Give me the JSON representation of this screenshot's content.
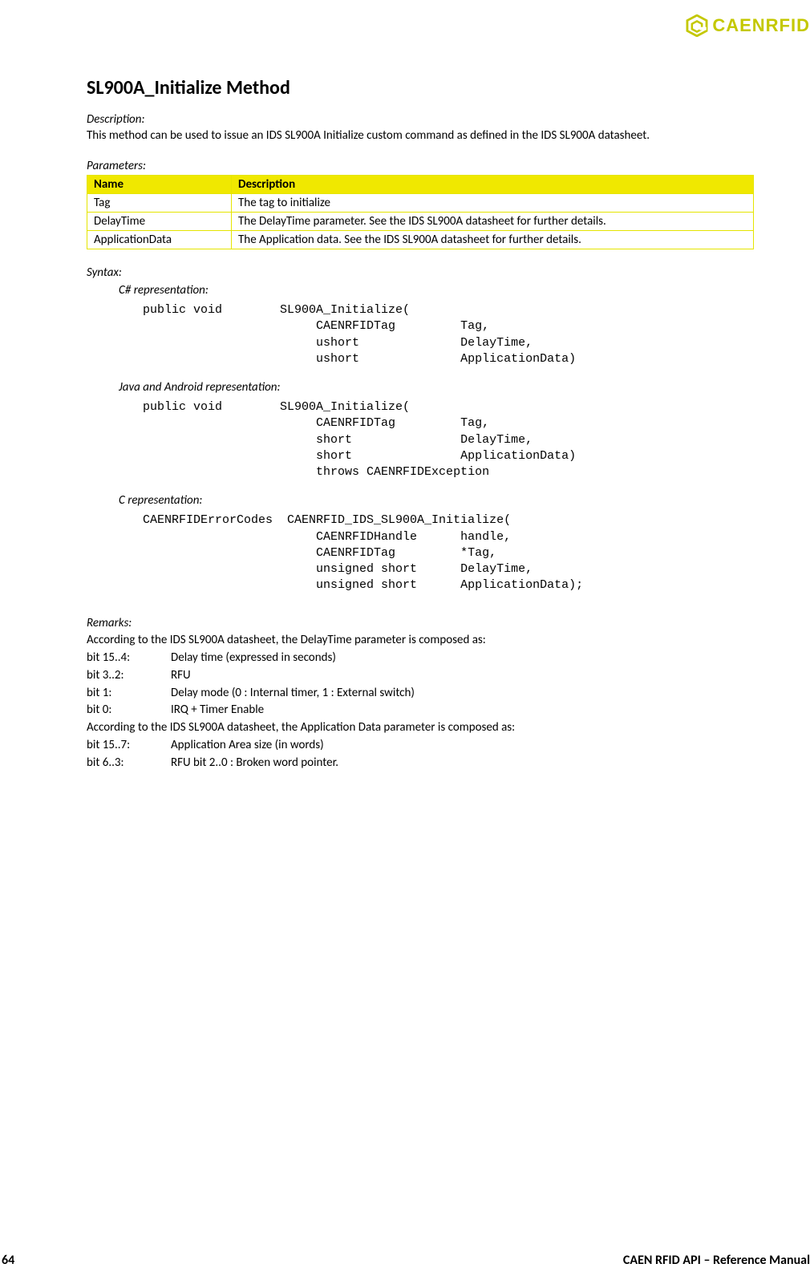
{
  "brand": {
    "name": "CAENRFID"
  },
  "title": "SL900A_Initialize Method",
  "description": {
    "label": "Description:",
    "text": "This method can be used to issue an IDS SL900A Initialize custom command as defined in the IDS SL900A datasheet."
  },
  "parameters": {
    "label": "Parameters:",
    "headers": {
      "name": "Name",
      "description": "Description"
    },
    "rows": [
      {
        "name": "Tag",
        "description": "The tag to initialize"
      },
      {
        "name": "DelayTime",
        "description": "The DelayTime parameter. See the IDS SL900A datasheet for further details."
      },
      {
        "name": "ApplicationData",
        "description": "The Application data. See the IDS SL900A datasheet for further details."
      }
    ]
  },
  "syntax": {
    "label": "Syntax:",
    "csharp": {
      "label": "C# representation:",
      "code": "public void        SL900A_Initialize(\n                        CAENRFIDTag         Tag,\n                        ushort              DelayTime,\n                        ushort              ApplicationData)"
    },
    "java": {
      "label": "Java and Android representation:",
      "code": "public void        SL900A_Initialize(\n                        CAENRFIDTag         Tag,\n                        short               DelayTime,\n                        short               ApplicationData)\n                        throws CAENRFIDException"
    },
    "c": {
      "label": "C representation:",
      "code": "CAENRFIDErrorCodes  CAENRFID_IDS_SL900A_Initialize(\n                        CAENRFIDHandle      handle,\n                        CAENRFIDTag         *Tag,\n                        unsigned short      DelayTime,\n                        unsigned short      ApplicationData);"
    }
  },
  "remarks": {
    "label": "Remarks:",
    "line1": "According to the IDS SL900A datasheet, the DelayTime parameter is composed as:",
    "bitsA": [
      {
        "b": "bit 15..4:",
        "d": "Delay time (expressed in seconds)"
      },
      {
        "b": "bit 3..2:",
        "d": "RFU"
      },
      {
        "b": "bit 1:",
        "d": "Delay mode (0 : Internal timer, 1 : External switch)"
      },
      {
        "b": "bit 0:",
        "d": "IRQ + Timer Enable"
      }
    ],
    "line2": "According to the IDS SL900A datasheet, the Application Data parameter is composed as:",
    "bitsB": [
      {
        "b": "bit 15..7:",
        "d": "Application Area size (in words)"
      },
      {
        "b": "bit 6..3:",
        "d": "RFU bit 2..0 : Broken word pointer."
      }
    ]
  },
  "footer": {
    "page": "64",
    "title": "CAEN RFID API – Reference Manual"
  }
}
